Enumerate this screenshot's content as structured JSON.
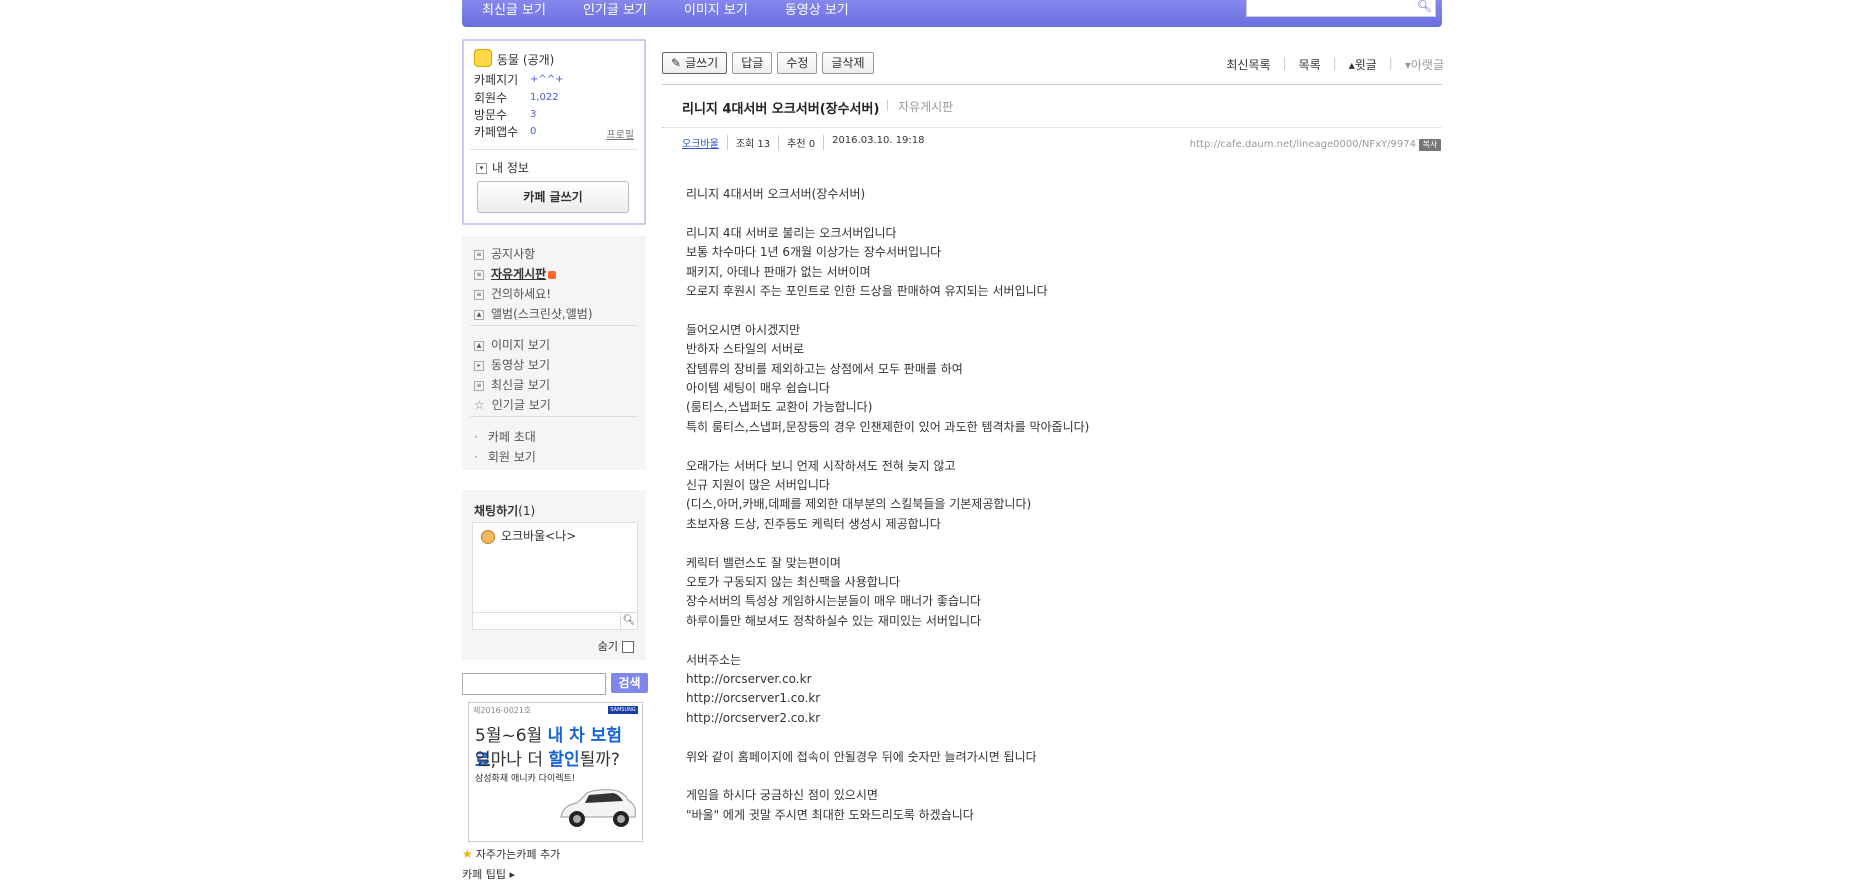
{
  "topnav": {
    "items": [
      "최신글 보기",
      "인기글 보기",
      "이미지 보기",
      "동영상 보기"
    ],
    "search_value": ""
  },
  "profile": {
    "cafe_name": "동물 (공개)",
    "rows": [
      {
        "label": "카페지기",
        "value": "+^^+"
      },
      {
        "label": "회원수",
        "value": "1,022"
      },
      {
        "label": "방문수",
        "value": "3"
      },
      {
        "label": "카페앱수",
        "value": "0"
      }
    ],
    "profile_link": "프로필",
    "my_info": "내 정보",
    "write_button": "카페 글쓰기"
  },
  "menu": {
    "group1": [
      "공지사항",
      "자유게시판",
      "건의하세요!",
      "앨범(스크린샷,앨범)"
    ],
    "group2": [
      "이미지 보기",
      "동영상 보기",
      "최신글 보기",
      "인기글 보기"
    ],
    "group3": [
      "카페 초대",
      "회원 보기"
    ]
  },
  "chat": {
    "title": "채팅하기",
    "count": "(1)",
    "user": "오크바울<나>",
    "hide_label": "숨기"
  },
  "cafe_search": {
    "value": "",
    "button": "검색"
  },
  "ad": {
    "reg": "제2016-0021호",
    "brand": "SAMSUNG",
    "line1_a": "5월~6월 ",
    "line1_b": "내 차 보험료",
    "line1_c": ",",
    "line2_a": "얼마나 더 ",
    "line2_b": "할인",
    "line2_c": "될까?",
    "line3": "삼성화재 애니카 다이렉트!"
  },
  "fav": "자주가는카페 추가",
  "tip": "카페 팁팁 ▸",
  "toolbar": {
    "write": "글쓰기",
    "reply": "답글",
    "edit": "수정",
    "delete": "글삭제"
  },
  "rightnav": {
    "latest": "최신목록",
    "list": "목록",
    "prev": "▴윗글",
    "next": "▾아랫글"
  },
  "post": {
    "title": "리니지 4대서버 오크서버(장수서버)",
    "board": "자유게시판",
    "author": "오크바울",
    "views": "조회 13",
    "recommend": "추천 0",
    "date": "2016.03.10. 19:18",
    "url": "http://cafe.daum.net/lineage0000/NFxY/9974",
    "copy": "복사",
    "lines": [
      "리니지 4대서버 오크서버(장수서버)",
      "",
      "리니지 4대 서버로 불리는 오크서버입니다",
      "보통 차수마다 1년 6개월 이상가는 장수서버입니다",
      "패키지, 아데나 판매가 없는 서버이며",
      "오로지 후원시 주는 포인트로 인한 드상을 판매하여 유지되는 서버입니다",
      "",
      "들어오시면 아시겠지만",
      "반하자 스타일의 서버로",
      "잡템류의 장비를 제외하고는 상점에서 모두 판매를 하여",
      "아이템 세팅이 매우 쉽습니다",
      "(룸티스,스냅퍼도 교환이 가능합니다)",
      "특히 룸티스,스냅퍼,문장등의 경우 인챈제한이 있어 과도한 템격차를 막아줍니다)",
      "",
      "오래가는 서버다 보니 언제 시작하셔도 전혀 늦지 않고",
      "신규 지원이 많은 서버입니다",
      "(디스,아머,카배,데페를 제외한 대부분의 스킬북들을 기본제공합니다)",
      "초보자용 드상, 진주등도 케릭터 생성시 제공합니다",
      "",
      "케릭터 밸런스도 잘 맞는편이며",
      "오토가 구동되지 않는 최신팩을 사용합니다",
      "장수서버의 특성상 게임하시는분들이 매우 매너가 좋습니다",
      "하루이틀만 해보셔도 정착하실수 있는 재미있는 서버입니다",
      "",
      "서버주소는",
      "http://orcserver.co.kr",
      "http://orcserver1.co.kr",
      "http://orcserver2.co.kr",
      "",
      "위와 같이 홈페이지에 접속이 안될경우 뒤에 숫자만 늘려가시면 됩니다",
      "",
      "게임을 하시다 궁금하신 점이 있으시면",
      "\"바울\" 에게 귓말 주시면 최대한 도와드리도록 하겠습니다"
    ]
  }
}
